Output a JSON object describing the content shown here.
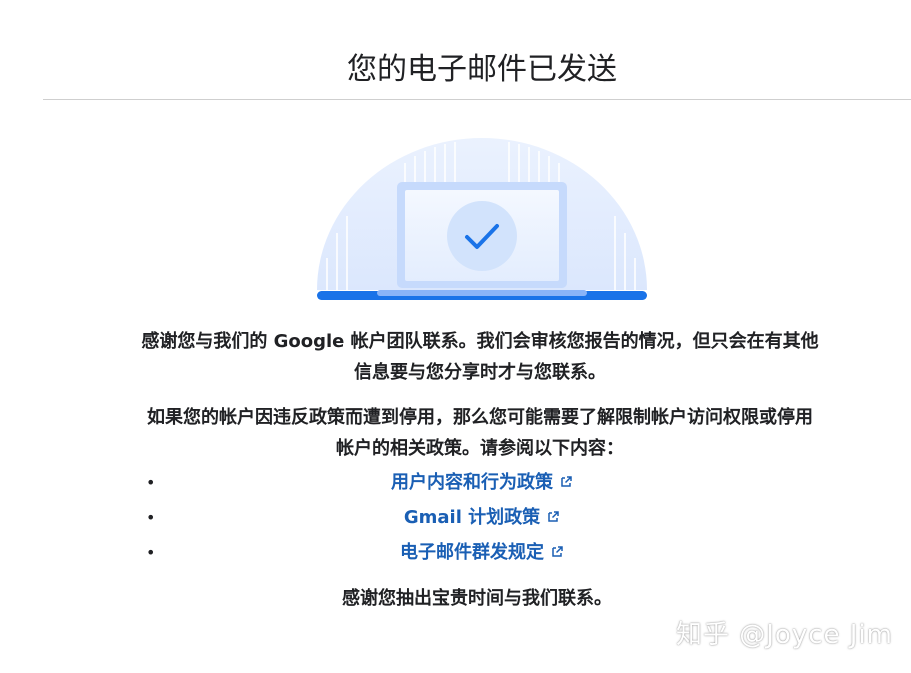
{
  "page": {
    "title": "您的电子邮件已发送"
  },
  "message": {
    "paragraph1": "感谢您与我们的 Google 帐户团队联系。我们会审核您报告的情况，但只会在有其他信息要与您分享时才与您联系。",
    "paragraph2": "如果您的帐户因违反政策而遭到停用，那么您可能需要了解限制帐户访问权限或停用帐户的相关政策。请参阅以下内容：",
    "closing": "感谢您抽出宝贵时间与我们联系。"
  },
  "links": [
    {
      "label": "用户内容和行为政策",
      "icon": "external-link-icon"
    },
    {
      "label": "Gmail 计划政策",
      "icon": "external-link-icon"
    },
    {
      "label": "电子邮件群发规定",
      "icon": "external-link-icon"
    }
  ],
  "illustration": {
    "icon": "checkmark-icon",
    "accent_color": "#1a73e8"
  },
  "watermark": {
    "text": "知乎 @Joyce Jim"
  },
  "colors": {
    "link": "#1a5fb4",
    "text": "#202124",
    "divider": "#cfcfcf"
  }
}
